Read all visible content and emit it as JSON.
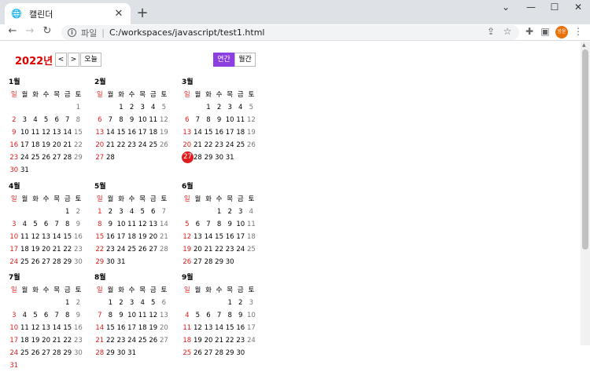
{
  "browser": {
    "tab_title": "캘린더",
    "scheme_label": "파일",
    "url": "C:/workspaces/javascript/test1.html",
    "profile_label": "방윤"
  },
  "calendar": {
    "year_label": "2022년",
    "prev_label": "<",
    "next_label": ">",
    "today_label": "오늘",
    "yearly_label": "연간",
    "monthly_label": "월간",
    "weekdays": [
      "일",
      "월",
      "화",
      "수",
      "목",
      "금",
      "토"
    ],
    "today": {
      "month": 3,
      "day": 27
    },
    "months": [
      {
        "label": "1월",
        "start": 6,
        "days": 31
      },
      {
        "label": "2월",
        "start": 2,
        "days": 28
      },
      {
        "label": "3월",
        "start": 2,
        "days": 31
      },
      {
        "label": "4월",
        "start": 5,
        "days": 30
      },
      {
        "label": "5월",
        "start": 0,
        "days": 31
      },
      {
        "label": "6월",
        "start": 3,
        "days": 30
      },
      {
        "label": "7월",
        "start": 5,
        "days": 31
      },
      {
        "label": "8월",
        "start": 1,
        "days": 31
      },
      {
        "label": "9월",
        "start": 4,
        "days": 30
      }
    ]
  }
}
